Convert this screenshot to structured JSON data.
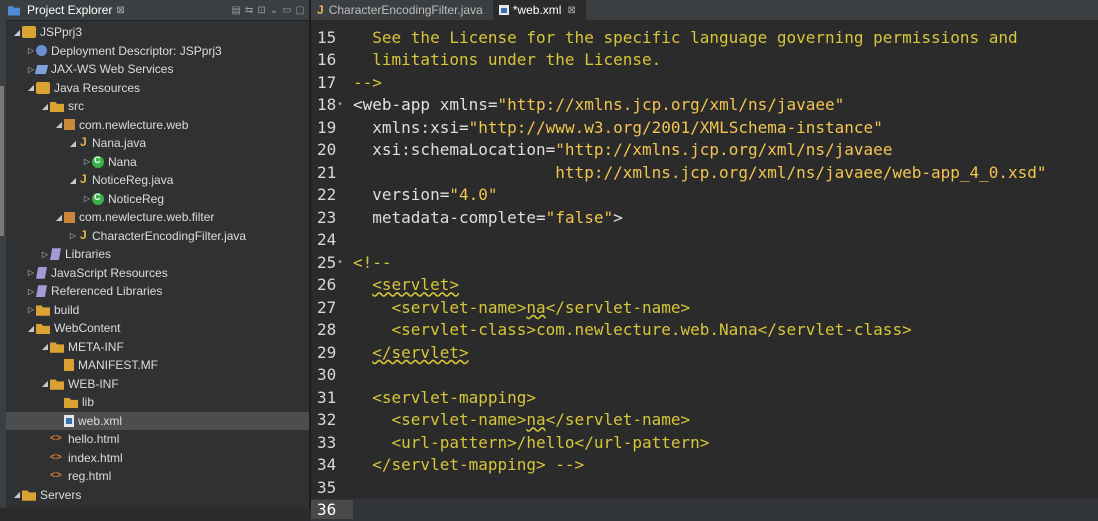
{
  "explorer": {
    "title": "Project Explorer",
    "close_glyph": "⊠",
    "items": [
      {
        "label": "JSPprj3",
        "depth": 0,
        "arrow": "◢",
        "icon": "project-icon",
        "cls": "proj"
      },
      {
        "label": "Deployment Descriptor: JSPprj3",
        "depth": 1,
        "arrow": "▷",
        "icon": "deployment-descriptor-icon",
        "cls": "dd"
      },
      {
        "label": "JAX-WS Web Services",
        "depth": 1,
        "arrow": "▷",
        "icon": "web-services-icon",
        "cls": "ws"
      },
      {
        "label": "Java Resources",
        "depth": 1,
        "arrow": "◢",
        "icon": "java-resources-icon",
        "cls": "proj"
      },
      {
        "label": "src",
        "depth": 2,
        "arrow": "◢",
        "icon": "source-folder-icon",
        "cls": "folder"
      },
      {
        "label": "com.newlecture.web",
        "depth": 3,
        "arrow": "◢",
        "icon": "package-icon",
        "cls": "pkg"
      },
      {
        "label": "Nana.java",
        "depth": 4,
        "arrow": "◢",
        "icon": "java-file-icon",
        "cls": "java"
      },
      {
        "label": "Nana",
        "depth": 5,
        "arrow": "▷",
        "icon": "class-icon",
        "cls": "cls"
      },
      {
        "label": "NoticeReg.java",
        "depth": 4,
        "arrow": "◢",
        "icon": "java-file-icon",
        "cls": "java"
      },
      {
        "label": "NoticeReg",
        "depth": 5,
        "arrow": "▷",
        "icon": "class-icon",
        "cls": "cls"
      },
      {
        "label": "com.newlecture.web.filter",
        "depth": 3,
        "arrow": "◢",
        "icon": "package-icon",
        "cls": "pkg"
      },
      {
        "label": "CharacterEncodingFilter.java",
        "depth": 4,
        "arrow": "▷",
        "icon": "java-file-icon",
        "cls": "java"
      },
      {
        "label": "Libraries",
        "depth": 2,
        "arrow": "▷",
        "icon": "library-icon",
        "cls": "lib"
      },
      {
        "label": "JavaScript Resources",
        "depth": 1,
        "arrow": "▷",
        "icon": "library-icon",
        "cls": "lib"
      },
      {
        "label": "Referenced Libraries",
        "depth": 1,
        "arrow": "▷",
        "icon": "library-icon",
        "cls": "lib"
      },
      {
        "label": "build",
        "depth": 1,
        "arrow": "▷",
        "icon": "folder-icon",
        "cls": "folder"
      },
      {
        "label": "WebContent",
        "depth": 1,
        "arrow": "◢",
        "icon": "folder-icon",
        "cls": "folder"
      },
      {
        "label": "META-INF",
        "depth": 2,
        "arrow": "◢",
        "icon": "folder-icon",
        "cls": "folder"
      },
      {
        "label": "MANIFEST.MF",
        "depth": 3,
        "arrow": "",
        "icon": "manifest-file-icon",
        "cls": "mf"
      },
      {
        "label": "WEB-INF",
        "depth": 2,
        "arrow": "◢",
        "icon": "folder-icon",
        "cls": "folder"
      },
      {
        "label": "lib",
        "depth": 3,
        "arrow": "",
        "icon": "folder-icon",
        "cls": "folder"
      },
      {
        "label": "web.xml",
        "depth": 3,
        "arrow": "",
        "icon": "xml-file-icon",
        "cls": "xml",
        "selected": true
      },
      {
        "label": "hello.html",
        "depth": 2,
        "arrow": "",
        "icon": "html-file-icon",
        "cls": "html"
      },
      {
        "label": "index.html",
        "depth": 2,
        "arrow": "",
        "icon": "html-file-icon",
        "cls": "html"
      },
      {
        "label": "reg.html",
        "depth": 2,
        "arrow": "",
        "icon": "html-file-icon",
        "cls": "html"
      },
      {
        "label": "Servers",
        "depth": 0,
        "arrow": "◢",
        "icon": "folder-icon",
        "cls": "folder"
      }
    ]
  },
  "editor": {
    "tabs": [
      {
        "label": "CharacterEncodingFilter.java",
        "active": false
      },
      {
        "label": "*web.xml",
        "active": true,
        "close": "⊠"
      }
    ],
    "lines": [
      {
        "n": "15",
        "segs": [
          {
            "t": "  See the License for the specific language governing permissions and",
            "c": "cm"
          }
        ]
      },
      {
        "n": "16",
        "segs": [
          {
            "t": "  limitations under the License.",
            "c": "cm"
          }
        ]
      },
      {
        "n": "17",
        "segs": [
          {
            "t": "-->",
            "c": "cm"
          }
        ]
      },
      {
        "n": "18",
        "fold": true,
        "segs": [
          {
            "t": "<web-app ",
            "c": "tg"
          },
          {
            "t": "xmlns",
            "c": "at"
          },
          {
            "t": "=",
            "c": "tg"
          },
          {
            "t": "\"http://xmlns.jcp.org/xml/ns/javaee\"",
            "c": "vl"
          }
        ]
      },
      {
        "n": "19",
        "segs": [
          {
            "t": "  xmlns:xsi",
            "c": "at"
          },
          {
            "t": "=",
            "c": "tg"
          },
          {
            "t": "\"http://www.w3.org/2001/XMLSchema-instance\"",
            "c": "vl"
          }
        ]
      },
      {
        "n": "20",
        "segs": [
          {
            "t": "  xsi:schemaLocation",
            "c": "at"
          },
          {
            "t": "=",
            "c": "tg"
          },
          {
            "t": "\"http://xmlns.jcp.org/xml/ns/javaee",
            "c": "vl"
          }
        ]
      },
      {
        "n": "21",
        "segs": [
          {
            "t": "                     http://xmlns.jcp.org/xml/ns/javaee/web-app_4_0.xsd\"",
            "c": "vl"
          }
        ]
      },
      {
        "n": "22",
        "segs": [
          {
            "t": "  version",
            "c": "at"
          },
          {
            "t": "=",
            "c": "tg"
          },
          {
            "t": "\"4.0\"",
            "c": "vl"
          }
        ]
      },
      {
        "n": "23",
        "segs": [
          {
            "t": "  metadata-complete",
            "c": "at"
          },
          {
            "t": "=",
            "c": "tg"
          },
          {
            "t": "\"false\"",
            "c": "vl"
          },
          {
            "t": ">",
            "c": "tg"
          }
        ]
      },
      {
        "n": "24",
        "segs": []
      },
      {
        "n": "25",
        "fold": true,
        "segs": [
          {
            "t": "<!--",
            "c": "cm"
          }
        ]
      },
      {
        "n": "26",
        "segs": [
          {
            "t": "  ",
            "c": "cm"
          },
          {
            "t": "<servlet>",
            "c": "cm ul"
          }
        ]
      },
      {
        "n": "27",
        "segs": [
          {
            "t": "    <servlet-name>",
            "c": "cm"
          },
          {
            "t": "na",
            "c": "cm ul"
          },
          {
            "t": "</servlet-name>",
            "c": "cm"
          }
        ]
      },
      {
        "n": "28",
        "segs": [
          {
            "t": "    <servlet-class>com.newlecture.web.Nana</servlet-class>",
            "c": "cm"
          }
        ]
      },
      {
        "n": "29",
        "segs": [
          {
            "t": "  ",
            "c": "cm"
          },
          {
            "t": "</servlet>",
            "c": "cm ul"
          }
        ]
      },
      {
        "n": "30",
        "segs": []
      },
      {
        "n": "31",
        "segs": [
          {
            "t": "  <servlet-mapping>",
            "c": "cm"
          }
        ]
      },
      {
        "n": "32",
        "segs": [
          {
            "t": "    <servlet-name>",
            "c": "cm"
          },
          {
            "t": "na",
            "c": "cm ul"
          },
          {
            "t": "</servlet-name>",
            "c": "cm"
          }
        ]
      },
      {
        "n": "33",
        "segs": [
          {
            "t": "    <url-pattern>/hello</url-pattern>",
            "c": "cm"
          }
        ]
      },
      {
        "n": "34",
        "segs": [
          {
            "t": "  </servlet-mapping> -->",
            "c": "cm"
          }
        ]
      },
      {
        "n": "35",
        "segs": []
      },
      {
        "n": "36",
        "segs": [],
        "current": true
      }
    ]
  }
}
